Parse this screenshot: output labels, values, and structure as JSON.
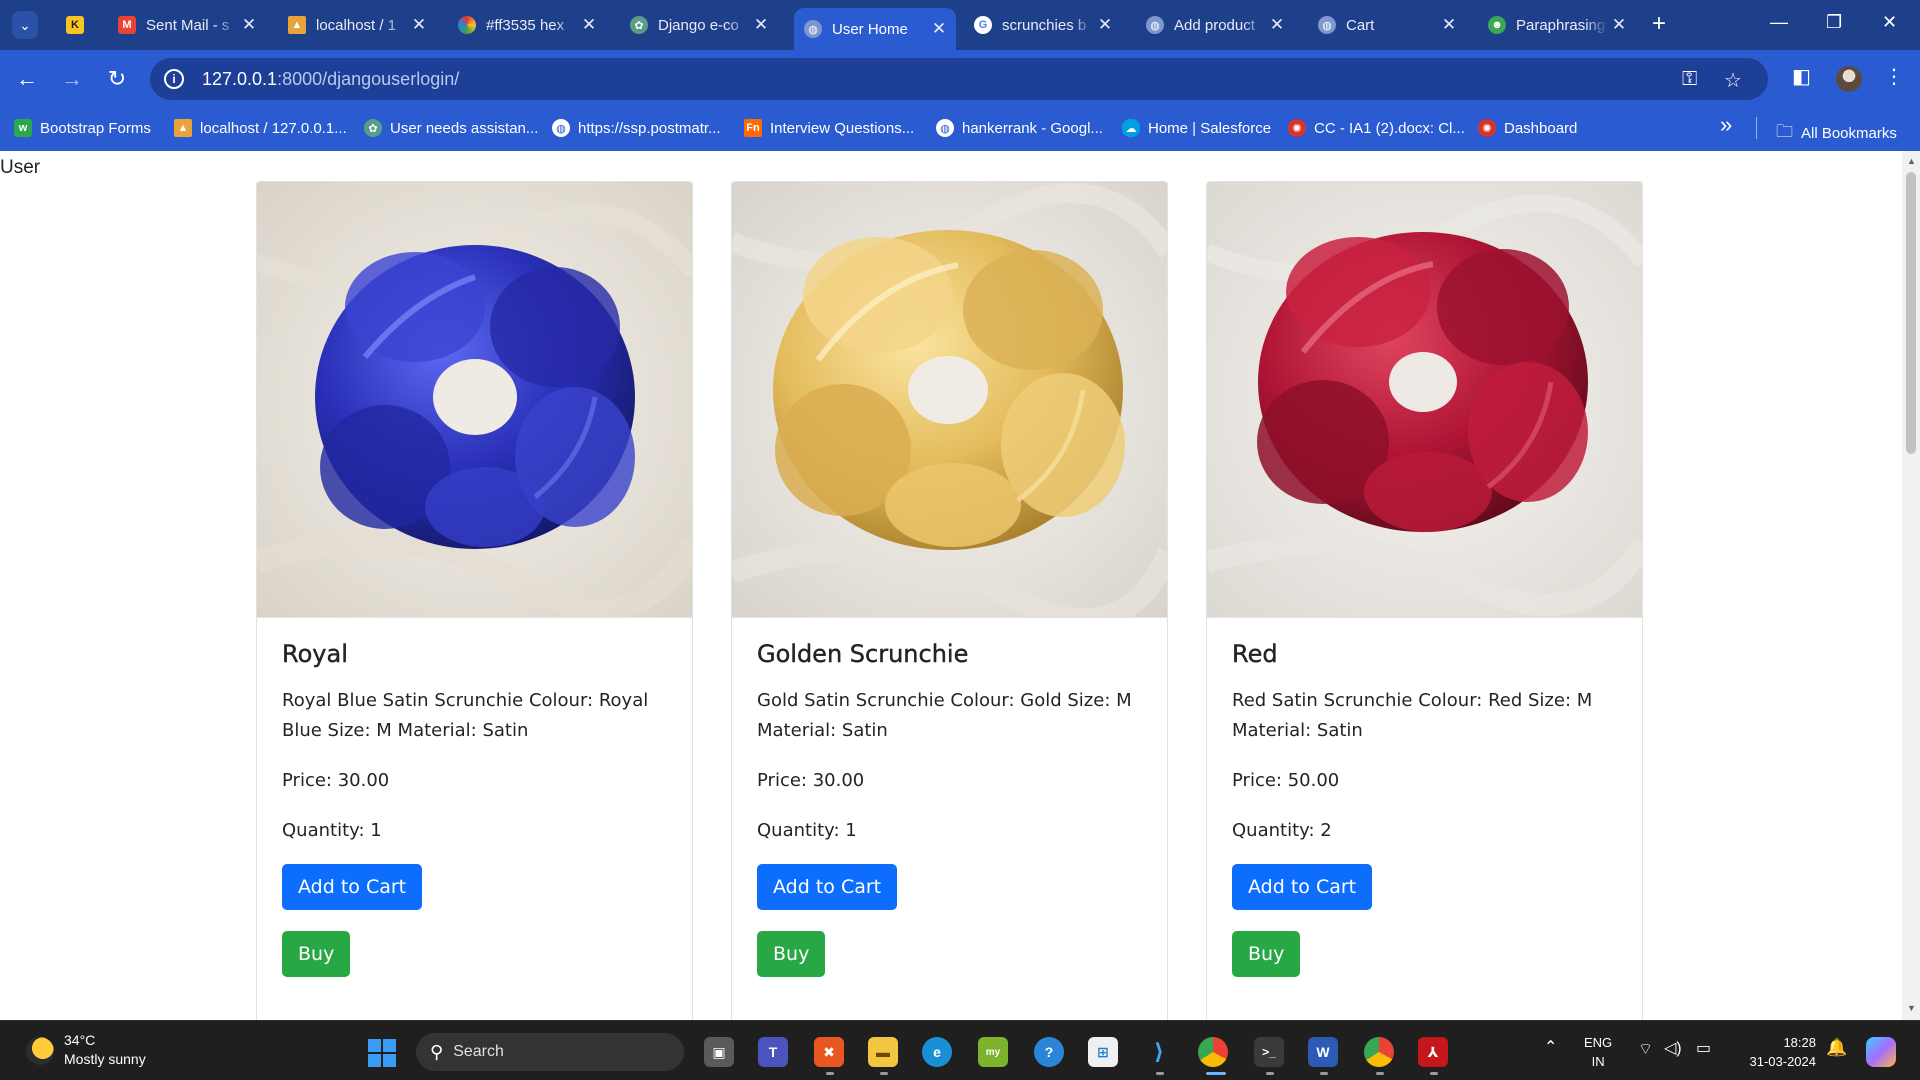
{
  "browser": {
    "tabs": [
      {
        "title": "",
        "active": false
      },
      {
        "title": "Sent Mail - s",
        "active": false
      },
      {
        "title": "localhost / 1",
        "active": false
      },
      {
        "title": "#ff3535 hex",
        "active": false
      },
      {
        "title": "Django e-co",
        "active": false
      },
      {
        "title": "User Home",
        "active": true
      },
      {
        "title": "scrunchies b",
        "active": false
      },
      {
        "title": "Add product",
        "active": false
      },
      {
        "title": "Cart",
        "active": false
      },
      {
        "title": "Paraphrasing",
        "active": false
      }
    ],
    "url_host": "127.0.0.1",
    "url_path": ":8000/djangouserlogin/",
    "bookmarks": [
      "Bootstrap Forms",
      "localhost / 127.0.0.1...",
      "User needs assistan...",
      "https://ssp.postmatr...",
      "Interview Questions...",
      "hankerrank - Googl...",
      "Home | Salesforce",
      "CC - IA1 (2).docx: Cl...",
      "Dashboard"
    ],
    "all_bookmarks_label": "All Bookmarks"
  },
  "page": {
    "user_label": "User",
    "products": [
      {
        "name": "Royal",
        "description": "Royal Blue Satin Scrunchie Colour: Royal Blue Size: M Material: Satin",
        "price": "Price: 30.00",
        "quantity": "Quantity: 1",
        "color": "#2a2fb8",
        "add_label": "Add to Cart",
        "buy_label": "Buy"
      },
      {
        "name": "Golden Scrunchie",
        "description": "Gold Satin Scrunchie Colour: Gold Size: M Material: Satin",
        "price": "Price: 30.00",
        "quantity": "Quantity: 1",
        "color": "#e8c265",
        "add_label": "Add to Cart",
        "buy_label": "Buy"
      },
      {
        "name": "Red",
        "description": "Red Satin Scrunchie Colour: Red Size: M Material: Satin",
        "price": "Price: 50.00",
        "quantity": "Quantity: 2",
        "color": "#b01535",
        "add_label": "Add to Cart",
        "buy_label": "Buy"
      }
    ]
  },
  "taskbar": {
    "weather_temp": "34°C",
    "weather_desc": "Mostly sunny",
    "search_placeholder": "Search",
    "lang_line1": "ENG",
    "lang_line2": "IN",
    "time": "18:28",
    "date": "31-03-2024"
  },
  "colors": {
    "primary": "#0d6efd",
    "success": "#28a745",
    "browser_frame": "#2a5bd1"
  }
}
